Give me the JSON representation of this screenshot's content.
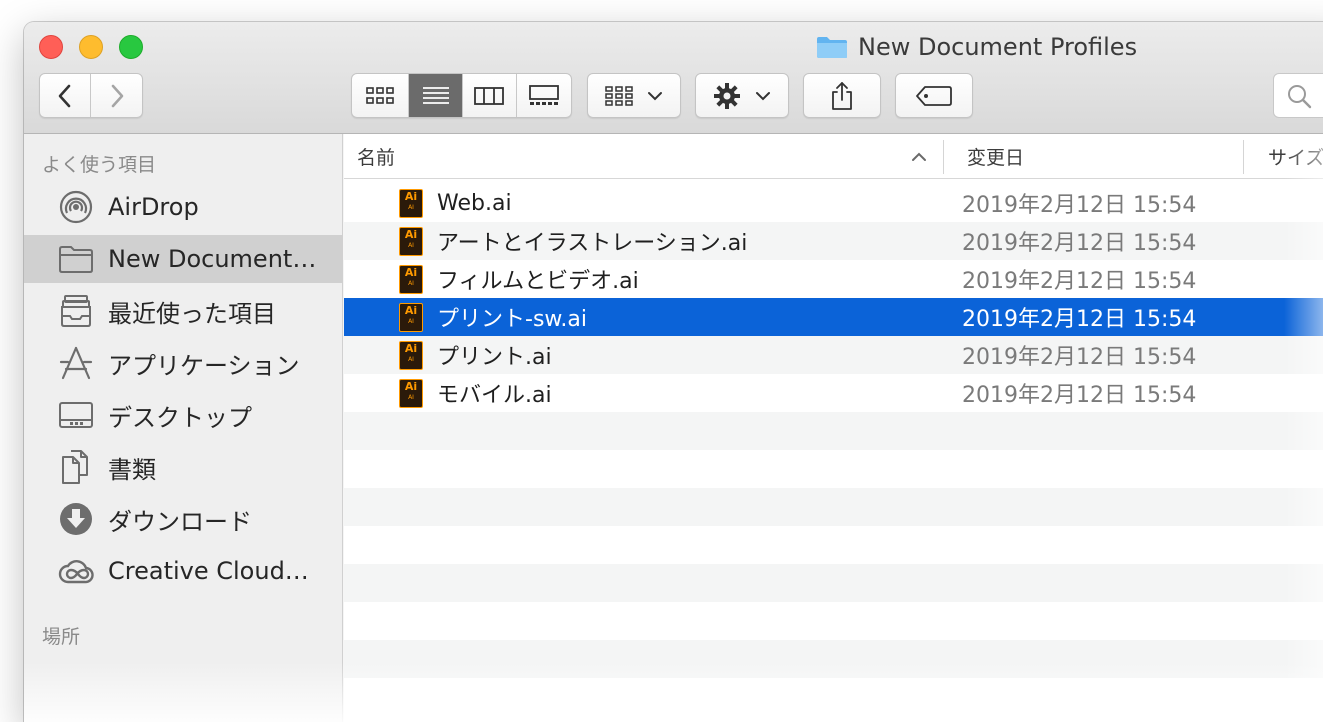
{
  "window": {
    "title": "New Document Profiles"
  },
  "toolbar": {
    "back_icon": "chevron-left-icon",
    "forward_icon": "chevron-right-icon",
    "view_modes": [
      "icon-view",
      "list-view",
      "column-view",
      "gallery-view"
    ],
    "active_view": "list-view"
  },
  "sidebar": {
    "favorites_header": "よく使う項目",
    "items": [
      {
        "label": "AirDrop",
        "icon": "airdrop-icon"
      },
      {
        "label": "New Document…",
        "icon": "folder-icon"
      },
      {
        "label": "最近使った項目",
        "icon": "recents-icon"
      },
      {
        "label": "アプリケーション",
        "icon": "applications-icon"
      },
      {
        "label": "デスクトップ",
        "icon": "desktop-icon"
      },
      {
        "label": "書類",
        "icon": "documents-icon"
      },
      {
        "label": "ダウンロード",
        "icon": "downloads-icon"
      },
      {
        "label": "Creative Cloud…",
        "icon": "creative-cloud-icon"
      }
    ],
    "places_header": "場所"
  },
  "columns": {
    "name": "名前",
    "date": "変更日",
    "size": "サイズ"
  },
  "files": [
    {
      "name": "Web.ai",
      "date": "2019年2月12日 15:54"
    },
    {
      "name": "アートとイラストレーション.ai",
      "date": "2019年2月12日 15:54"
    },
    {
      "name": "フィルムとビデオ.ai",
      "date": "2019年2月12日 15:54"
    },
    {
      "name": "プリント-sw.ai",
      "date": "2019年2月12日 15:54"
    },
    {
      "name": "プリント.ai",
      "date": "2019年2月12日 15:54"
    },
    {
      "name": "モバイル.ai",
      "date": "2019年2月12日 15:54"
    }
  ],
  "selected_file": "プリント-sw.ai",
  "colors": {
    "selection": "#0b63d8",
    "ai_icon": "#ff9a00"
  }
}
